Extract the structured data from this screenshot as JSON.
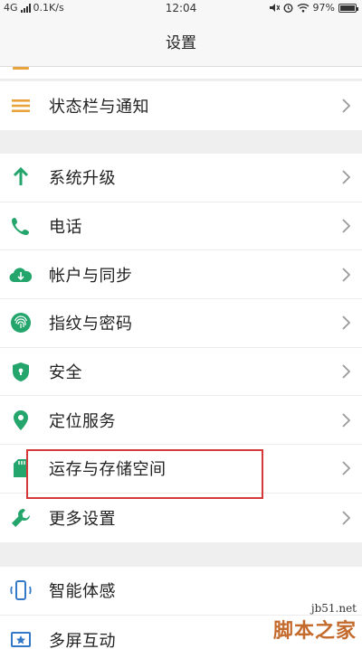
{
  "status_bar": {
    "network": "4G",
    "speed": "0.1K/s",
    "time": "12:04",
    "battery": "97%",
    "battery_level": 0.97
  },
  "header": {
    "title": "设置"
  },
  "sections": [
    {
      "items": [
        {
          "label": "状态栏与通知",
          "icon": "menu-lines-icon",
          "color": "#e8a33b"
        }
      ]
    },
    {
      "items": [
        {
          "label": "系统升级",
          "icon": "arrow-up-icon",
          "color": "#23a56b"
        },
        {
          "label": "电话",
          "icon": "phone-icon",
          "color": "#23a56b"
        },
        {
          "label": "帐户与同步",
          "icon": "cloud-sync-icon",
          "color": "#23a56b"
        },
        {
          "label": "指纹与密码",
          "icon": "fingerprint-icon",
          "color": "#23a56b"
        },
        {
          "label": "安全",
          "icon": "shield-icon",
          "color": "#23a56b"
        },
        {
          "label": "定位服务",
          "icon": "location-pin-icon",
          "color": "#23a56b"
        },
        {
          "label": "运存与存储空间",
          "icon": "sd-card-icon",
          "color": "#23a56b"
        },
        {
          "label": "更多设置",
          "icon": "wrench-icon",
          "color": "#23a56b"
        }
      ]
    },
    {
      "items": [
        {
          "label": "智能体感",
          "icon": "phone-gesture-icon",
          "color": "#3478c8"
        },
        {
          "label": "多屏互动",
          "icon": "multi-screen-icon",
          "color": "#3478c8"
        }
      ]
    }
  ],
  "highlight_color": "#d6393a",
  "watermark": {
    "url": "jb51.net",
    "name": "脚本之家"
  }
}
